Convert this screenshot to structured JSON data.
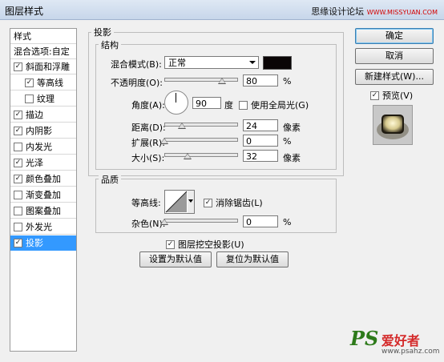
{
  "window": {
    "title": "图层样式"
  },
  "watermark": {
    "cn": "思缘设计论坛",
    "url": "WWW.MISSYUAN.COM"
  },
  "left_panel": {
    "header": "样式",
    "blend_options": "混合选项:自定",
    "items": [
      {
        "label": "斜面和浮雕",
        "checked": true,
        "indent": false
      },
      {
        "label": "等高线",
        "checked": true,
        "indent": true
      },
      {
        "label": "纹理",
        "checked": false,
        "indent": true
      },
      {
        "label": "描边",
        "checked": true,
        "indent": false
      },
      {
        "label": "内阴影",
        "checked": true,
        "indent": false
      },
      {
        "label": "内发光",
        "checked": false,
        "indent": false
      },
      {
        "label": "光泽",
        "checked": true,
        "indent": false
      },
      {
        "label": "颜色叠加",
        "checked": true,
        "indent": false
      },
      {
        "label": "渐变叠加",
        "checked": false,
        "indent": false
      },
      {
        "label": "图案叠加",
        "checked": false,
        "indent": false
      },
      {
        "label": "外发光",
        "checked": false,
        "indent": false
      },
      {
        "label": "投影",
        "checked": true,
        "indent": false,
        "selected": true
      }
    ]
  },
  "drop_shadow": {
    "title": "投影",
    "structure": {
      "title": "结构",
      "blend_mode_label": "混合模式(B):",
      "blend_mode_value": "正常",
      "shadow_color": "#0a0506",
      "opacity_label": "不透明度(O):",
      "opacity_value": "80",
      "opacity_level": 80,
      "unit_percent": "%",
      "angle_label": "角度(A):",
      "angle_value": "90",
      "angle_unit": "度",
      "global_light_label": "使用全局光(G)",
      "global_light_checked": false,
      "distance_label": "距离(D):",
      "distance_value": "24",
      "distance_level": 24,
      "unit_px": "像素",
      "spread_label": "扩展(R):",
      "spread_value": "0",
      "spread_level": 0,
      "size_label": "大小(S):",
      "size_value": "32",
      "size_level": 32
    },
    "quality": {
      "title": "品质",
      "contour_label": "等高线:",
      "antialias_label": "消除锯齿(L)",
      "antialias_checked": true,
      "noise_label": "杂色(N):",
      "noise_value": "0",
      "noise_level": 0
    },
    "knockout_label": "图层挖空投影(U)",
    "knockout_checked": true,
    "make_default": "设置为默认值",
    "reset_default": "复位为默认值"
  },
  "buttons": {
    "ok": "确定",
    "cancel": "取消",
    "new_style": "新建样式(W)...",
    "preview_label": "预览(V)",
    "preview_checked": true
  },
  "logo": {
    "ps": "PS",
    "cn": "爱好者",
    "url": "www.psahz.com"
  }
}
